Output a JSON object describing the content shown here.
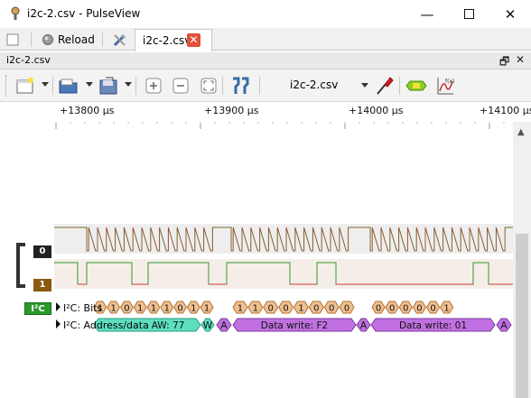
{
  "window": {
    "title": "i2c-2.csv - PulseView",
    "icon": "pulseview-probe-icon",
    "controls": [
      "minimize-icon",
      "maximize-icon",
      "close-icon"
    ]
  },
  "tabstrip": {
    "reload_label": "Reload",
    "file_tab_label": "i2c-2.csv",
    "file_tab_close": "✕"
  },
  "dock": {
    "title": "i2c-2.csv",
    "float_glyph": "🗗",
    "close_glyph": "✕"
  },
  "toolbar": {
    "device_name": "i2c-2.csv"
  },
  "ruler": {
    "labels": [
      "+13800 µs",
      "+13900 µs",
      "+14000 µs",
      "+14100 µs"
    ]
  },
  "channels": {
    "ch0_label": "0",
    "ch1_label": "1",
    "ch0_color": "#2a2a2a",
    "ch1_color": "#8a5a12"
  },
  "decoder": {
    "badge": "I²C",
    "bits_row_label": "I²C: Bits",
    "addr_row_label": "I²C: Address/data",
    "bits": [
      "1",
      "1",
      "0",
      "1",
      "1",
      "1",
      "0",
      "1",
      "1",
      "1",
      "1",
      "0",
      "0",
      "1",
      "0",
      "0",
      "0",
      "0",
      "0",
      "0",
      "0",
      "0",
      "1"
    ],
    "addr_annotations": [
      {
        "text": "AW: 77",
        "kind": "addr"
      },
      {
        "text": "W",
        "kind": "rw"
      },
      {
        "text": "A",
        "kind": "ack"
      },
      {
        "text": "Data write: F2",
        "kind": "data"
      },
      {
        "text": "A",
        "kind": "ack"
      },
      {
        "text": "Data write: 01",
        "kind": "data"
      },
      {
        "text": "A",
        "kind": "ack"
      }
    ],
    "colors": {
      "bits": "#f0c090",
      "bits_stroke": "#b07030",
      "addr": "#5ee0c0",
      "addr_stroke": "#2a9a80",
      "data": "#c070e0",
      "data_stroke": "#7a3aa0",
      "badge": "#2a9a2a"
    }
  }
}
